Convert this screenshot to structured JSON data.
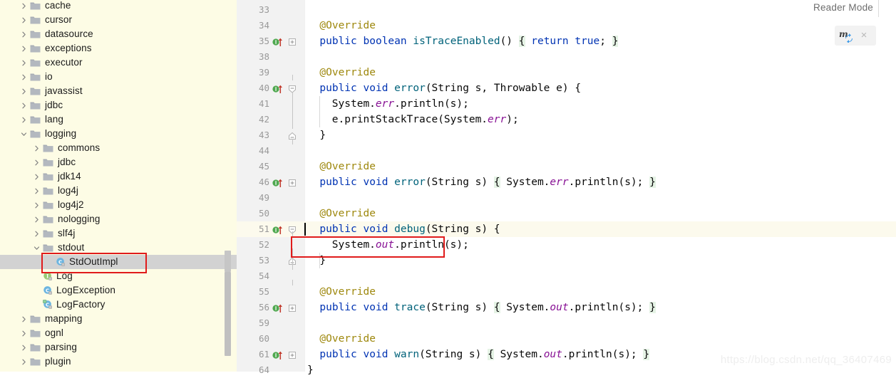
{
  "sidebar": {
    "background": "#fdfce5",
    "selection_color": "#d2d2d2",
    "tree": [
      {
        "label": "cache",
        "indent": 0,
        "type": "folder",
        "expanded": false
      },
      {
        "label": "cursor",
        "indent": 0,
        "type": "folder",
        "expanded": false
      },
      {
        "label": "datasource",
        "indent": 0,
        "type": "folder",
        "expanded": false
      },
      {
        "label": "exceptions",
        "indent": 0,
        "type": "folder",
        "expanded": false
      },
      {
        "label": "executor",
        "indent": 0,
        "type": "folder",
        "expanded": false
      },
      {
        "label": "io",
        "indent": 0,
        "type": "folder",
        "expanded": false
      },
      {
        "label": "javassist",
        "indent": 0,
        "type": "folder",
        "expanded": false
      },
      {
        "label": "jdbc",
        "indent": 0,
        "type": "folder",
        "expanded": false
      },
      {
        "label": "lang",
        "indent": 0,
        "type": "folder",
        "expanded": false
      },
      {
        "label": "logging",
        "indent": 0,
        "type": "folder",
        "expanded": true
      },
      {
        "label": "commons",
        "indent": 1,
        "type": "folder",
        "expanded": false
      },
      {
        "label": "jdbc",
        "indent": 1,
        "type": "folder",
        "expanded": false
      },
      {
        "label": "jdk14",
        "indent": 1,
        "type": "folder",
        "expanded": false
      },
      {
        "label": "log4j",
        "indent": 1,
        "type": "folder",
        "expanded": false
      },
      {
        "label": "log4j2",
        "indent": 1,
        "type": "folder",
        "expanded": false
      },
      {
        "label": "nologging",
        "indent": 1,
        "type": "folder",
        "expanded": false
      },
      {
        "label": "slf4j",
        "indent": 1,
        "type": "folder",
        "expanded": false
      },
      {
        "label": "stdout",
        "indent": 1,
        "type": "folder",
        "expanded": true
      },
      {
        "label": "StdOutImpl",
        "indent": 2,
        "type": "class",
        "selected": true
      },
      {
        "label": "Log",
        "indent": 1,
        "type": "interface"
      },
      {
        "label": "LogException",
        "indent": 1,
        "type": "class"
      },
      {
        "label": "LogFactory",
        "indent": 1,
        "type": "class-final"
      },
      {
        "label": "mapping",
        "indent": 0,
        "type": "folder",
        "expanded": false
      },
      {
        "label": "ognl",
        "indent": 0,
        "type": "folder",
        "expanded": false
      },
      {
        "label": "parsing",
        "indent": 0,
        "type": "folder",
        "expanded": false
      },
      {
        "label": "plugin",
        "indent": 0,
        "type": "folder",
        "expanded": false
      }
    ]
  },
  "editor": {
    "gutter_bg": "#f2f2f2",
    "caret_line_bg": "#fcfaed",
    "lines": [
      {
        "no": "33",
        "marker": false,
        "fold": "",
        "tokens": []
      },
      {
        "no": "34",
        "marker": false,
        "fold": "",
        "indent": 1,
        "tokens": [
          {
            "t": "@Override",
            "c": "ann"
          }
        ]
      },
      {
        "no": "35",
        "marker": true,
        "fold": "plus",
        "indent": 1,
        "tokens": [
          {
            "t": "public ",
            "c": "kw"
          },
          {
            "t": "boolean ",
            "c": "kw"
          },
          {
            "t": "isTraceEnabled",
            "c": "mth"
          },
          {
            "t": "() ",
            "c": "typ"
          },
          {
            "t": "{",
            "c": "brc"
          },
          {
            "t": " ",
            "c": "typ"
          },
          {
            "t": "return ",
            "c": "kw"
          },
          {
            "t": "true",
            "c": "kw"
          },
          {
            "t": "; ",
            "c": "typ"
          },
          {
            "t": "}",
            "c": "brc"
          }
        ]
      },
      {
        "no": "38",
        "marker": false,
        "fold": "",
        "tokens": []
      },
      {
        "no": "39",
        "marker": false,
        "fold": "",
        "indent": 1,
        "tokens": [
          {
            "t": "@Override",
            "c": "ann"
          }
        ]
      },
      {
        "no": "40",
        "marker": true,
        "fold": "minus-top",
        "indent": 1,
        "tokens": [
          {
            "t": "public ",
            "c": "kw"
          },
          {
            "t": "void ",
            "c": "kw"
          },
          {
            "t": "error",
            "c": "mth"
          },
          {
            "t": "(String s, Throwable e) {",
            "c": "typ"
          }
        ]
      },
      {
        "no": "41",
        "marker": false,
        "fold": "",
        "indent": 2,
        "tokens": [
          {
            "t": "System.",
            "c": "typ"
          },
          {
            "t": "err",
            "c": "stat"
          },
          {
            "t": ".println(s);",
            "c": "typ"
          }
        ]
      },
      {
        "no": "42",
        "marker": false,
        "fold": "",
        "indent": 2,
        "tokens": [
          {
            "t": "e.printStackTrace(System.",
            "c": "typ"
          },
          {
            "t": "err",
            "c": "stat"
          },
          {
            "t": ");",
            "c": "typ"
          }
        ]
      },
      {
        "no": "43",
        "marker": false,
        "fold": "minus-bot",
        "indent": 1,
        "tokens": [
          {
            "t": "}",
            "c": "typ"
          }
        ]
      },
      {
        "no": "44",
        "marker": false,
        "fold": "",
        "tokens": []
      },
      {
        "no": "45",
        "marker": false,
        "fold": "",
        "indent": 1,
        "tokens": [
          {
            "t": "@Override",
            "c": "ann"
          }
        ]
      },
      {
        "no": "46",
        "marker": true,
        "fold": "plus",
        "indent": 1,
        "tokens": [
          {
            "t": "public ",
            "c": "kw"
          },
          {
            "t": "void ",
            "c": "kw"
          },
          {
            "t": "error",
            "c": "mth"
          },
          {
            "t": "(String s) ",
            "c": "typ"
          },
          {
            "t": "{",
            "c": "brc"
          },
          {
            "t": " System.",
            "c": "typ"
          },
          {
            "t": "err",
            "c": "stat"
          },
          {
            "t": ".println(s); ",
            "c": "typ"
          },
          {
            "t": "}",
            "c": "brc"
          }
        ]
      },
      {
        "no": "49",
        "marker": false,
        "fold": "",
        "tokens": []
      },
      {
        "no": "50",
        "marker": false,
        "fold": "",
        "indent": 1,
        "tokens": [
          {
            "t": "@Override",
            "c": "ann"
          }
        ]
      },
      {
        "no": "51",
        "marker": true,
        "fold": "minus-top",
        "indent": 1,
        "caret": true,
        "tokens": [
          {
            "t": "public ",
            "c": "kw"
          },
          {
            "t": "void ",
            "c": "kw"
          },
          {
            "t": "debug",
            "c": "mth"
          },
          {
            "t": "(String s) {",
            "c": "typ"
          }
        ]
      },
      {
        "no": "52",
        "marker": false,
        "fold": "",
        "indent": 2,
        "tokens": [
          {
            "t": "System.",
            "c": "typ"
          },
          {
            "t": "out",
            "c": "stat"
          },
          {
            "t": ".println(s);",
            "c": "typ"
          }
        ]
      },
      {
        "no": "53",
        "marker": false,
        "fold": "minus-bot",
        "indent": 1,
        "tokens": [
          {
            "t": "}",
            "c": "typ"
          }
        ]
      },
      {
        "no": "54",
        "marker": false,
        "fold": "",
        "tokens": []
      },
      {
        "no": "55",
        "marker": false,
        "fold": "",
        "indent": 1,
        "tokens": [
          {
            "t": "@Override",
            "c": "ann"
          }
        ]
      },
      {
        "no": "56",
        "marker": true,
        "fold": "plus",
        "indent": 1,
        "tokens": [
          {
            "t": "public ",
            "c": "kw"
          },
          {
            "t": "void ",
            "c": "kw"
          },
          {
            "t": "trace",
            "c": "mth"
          },
          {
            "t": "(String s) ",
            "c": "typ"
          },
          {
            "t": "{",
            "c": "brc"
          },
          {
            "t": " System.",
            "c": "typ"
          },
          {
            "t": "out",
            "c": "stat"
          },
          {
            "t": ".println(s); ",
            "c": "typ"
          },
          {
            "t": "}",
            "c": "brc"
          }
        ]
      },
      {
        "no": "59",
        "marker": false,
        "fold": "",
        "tokens": []
      },
      {
        "no": "60",
        "marker": false,
        "fold": "",
        "indent": 1,
        "tokens": [
          {
            "t": "@Override",
            "c": "ann"
          }
        ]
      },
      {
        "no": "61",
        "marker": true,
        "fold": "plus",
        "indent": 1,
        "tokens": [
          {
            "t": "public ",
            "c": "kw"
          },
          {
            "t": "void ",
            "c": "kw"
          },
          {
            "t": "warn",
            "c": "mth"
          },
          {
            "t": "(String s) ",
            "c": "typ"
          },
          {
            "t": "{",
            "c": "brc"
          },
          {
            "t": " System.",
            "c": "typ"
          },
          {
            "t": "out",
            "c": "stat"
          },
          {
            "t": ".println(s); ",
            "c": "typ"
          },
          {
            "t": "}",
            "c": "brc"
          }
        ]
      },
      {
        "no": "64",
        "marker": false,
        "fold": "",
        "indent": 0,
        "tokens": [
          {
            "t": "}",
            "c": "typ"
          }
        ]
      }
    ]
  },
  "toolbar": {
    "reader_mode_label": "Reader Mode",
    "mybatis_icon_label": "m",
    "close_label": "×"
  },
  "annotations": {
    "tree_highlight_color": "#e01b1b",
    "code_highlight_color": "#e01b1b"
  },
  "watermark": {
    "text": "https://blog.csdn.net/qq_36407469"
  }
}
